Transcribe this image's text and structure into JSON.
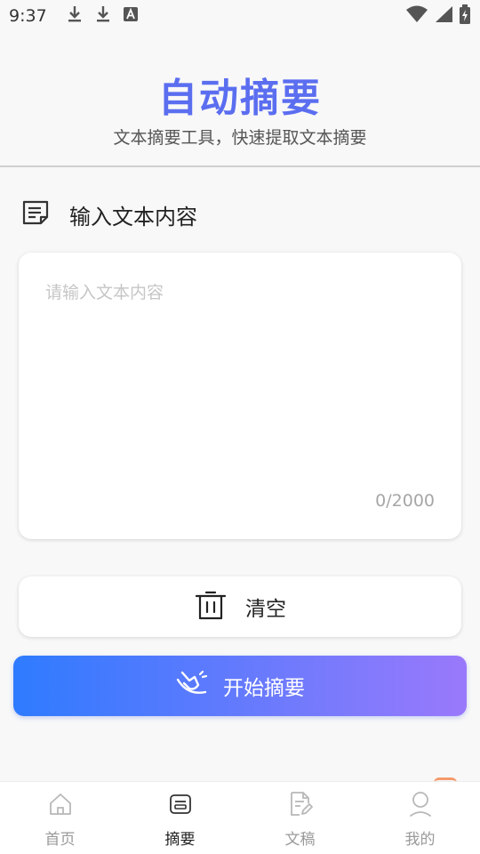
{
  "status_bar": {
    "time": "9:37",
    "left_icons": [
      "download-icon",
      "download-icon",
      "font-a-icon"
    ],
    "right_icons": [
      "wifi-icon",
      "cellular-signal-icon",
      "battery-charging-icon"
    ]
  },
  "header": {
    "title": "自动摘要",
    "subtitle": "文本摘要工具，快速提取文本摘要"
  },
  "input_section": {
    "icon": "document-lines-icon",
    "title": "输入文本内容",
    "placeholder": "请输入文本内容",
    "value": "",
    "char_count": "0/2000"
  },
  "actions": {
    "clear_icon": "trash-icon",
    "clear_label": "清空",
    "summarize_icon": "magic-hand-icon",
    "summarize_label": "开始摘要"
  },
  "bottom_nav": {
    "items": [
      {
        "label": "首页",
        "icon": "home-icon"
      },
      {
        "label": "摘要",
        "icon": "summary-list-icon",
        "active": true
      },
      {
        "label": "文稿",
        "icon": "document-edit-icon"
      },
      {
        "label": "我的",
        "icon": "user-icon"
      }
    ]
  },
  "colors": {
    "title": "#5b6ef0",
    "gradient_start": "#2e7bff",
    "gradient_end": "#9a79fb",
    "background": "#f8f8f8"
  }
}
